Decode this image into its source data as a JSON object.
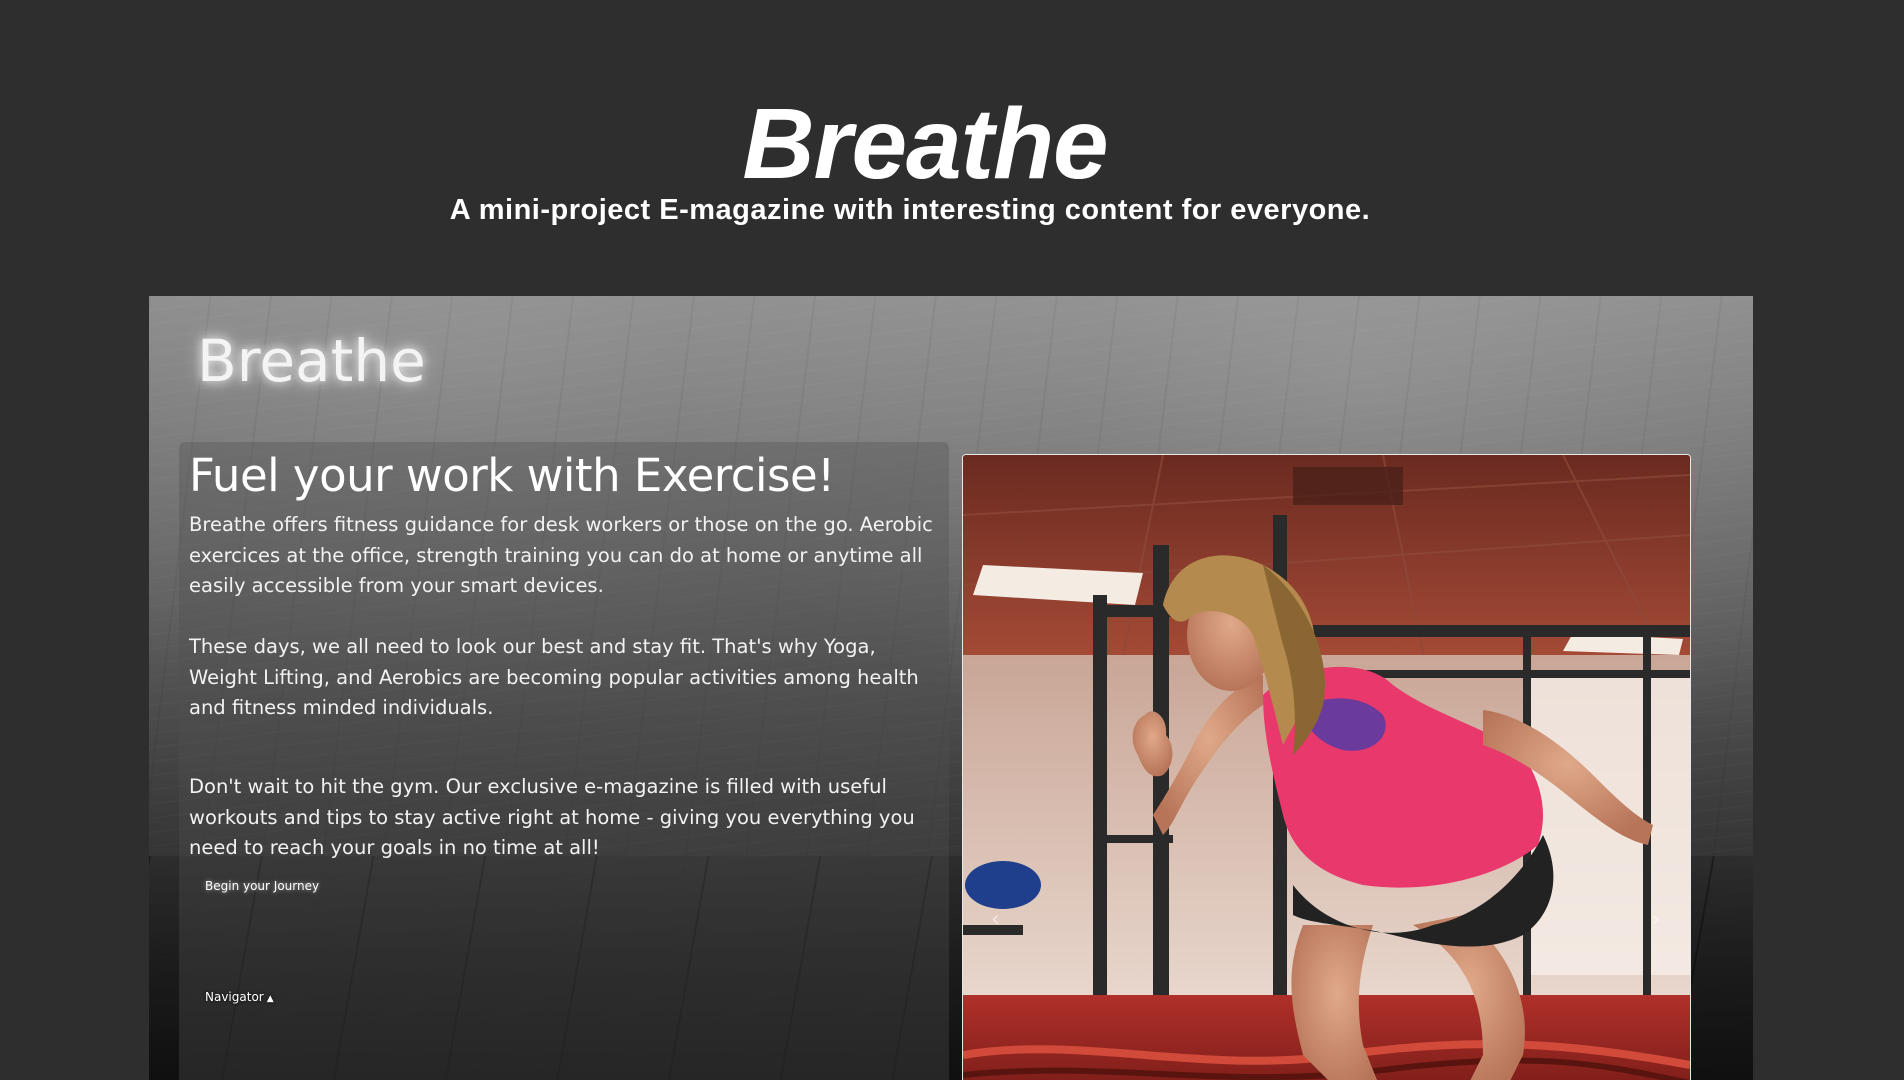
{
  "hero": {
    "title": "Breathe",
    "subtitle": "A mini-project E-magazine with interesting content for everyone."
  },
  "preview": {
    "brand": "Breathe",
    "heading": "Fuel your work with Exercise!",
    "paragraphs": [
      "Breathe offers fitness guidance for desk workers or those on the go. Aerobic exercices at the office, strength training you can do at home or anytime all easily accessible from your smart devices.",
      "These days, we all need to look our best and stay fit. That's why Yoga, Weight Lifting, and Aerobics are becoming popular activities among health and fitness minded individuals.",
      "Don't wait to hit the gym. Our exclusive e-magazine is filled with useful workouts and tips to stay active right at home - giving you everything you need to reach your goals in no time at all!"
    ],
    "cta_label": "Begin your Journey",
    "navigator_label": "Navigator",
    "carousel": {
      "prev_icon": "chevron-left-icon",
      "next_icon": "chevron-right-icon",
      "prev_glyph": "‹",
      "next_glyph": "›",
      "current_image": "woman exercising in gym"
    }
  },
  "colors": {
    "page_background": "#2e2e2e",
    "text": "#ffffff",
    "shirt_accent": "#e8386c"
  }
}
